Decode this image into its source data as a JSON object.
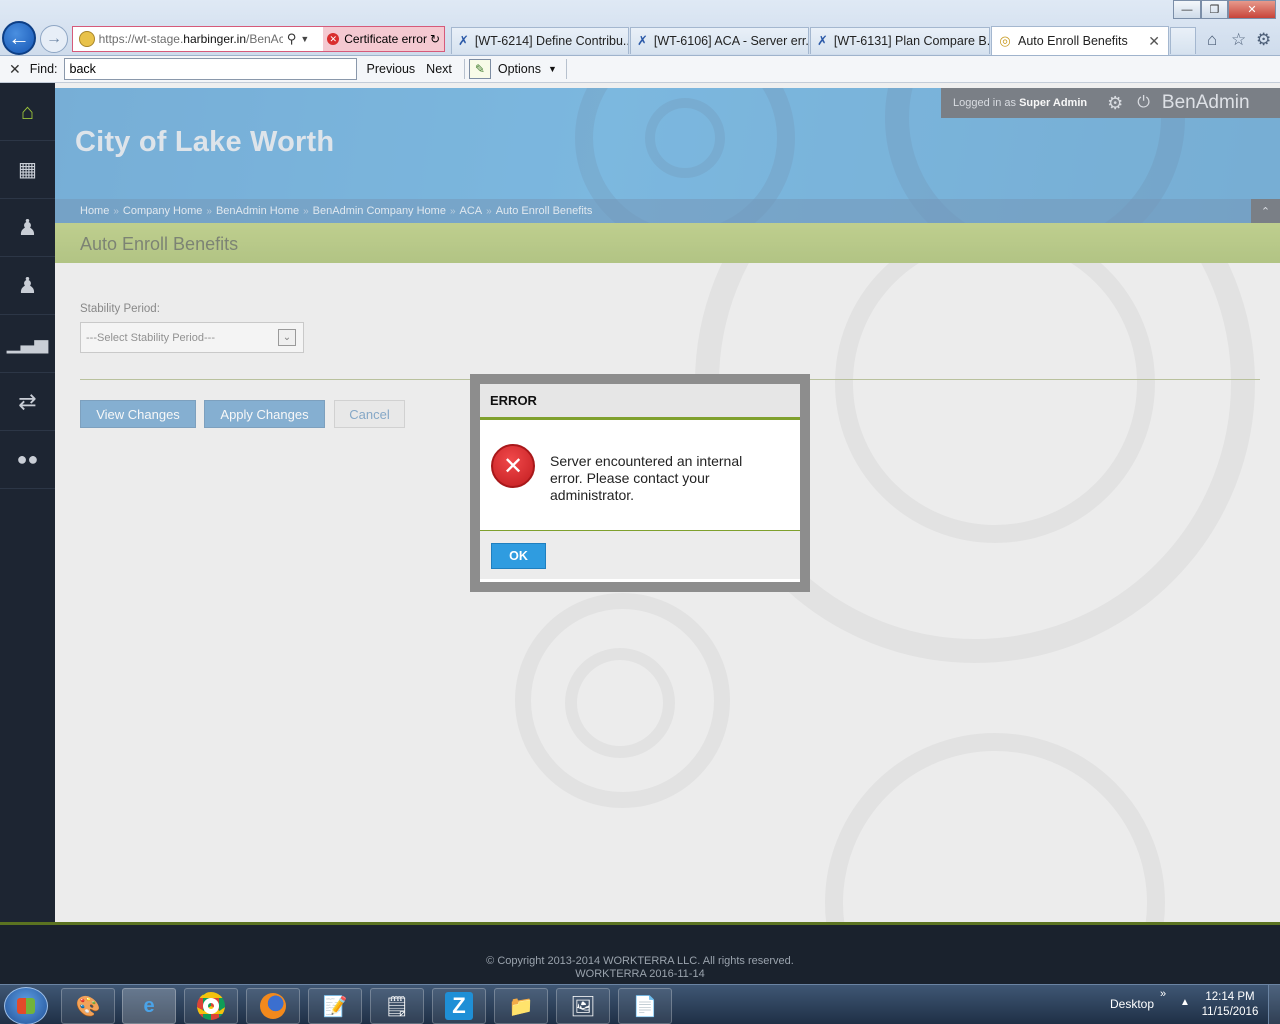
{
  "browser": {
    "url_prefix": "https://wt-stage.",
    "url_domain": "harbinger.in",
    "url_suffix": "/BenAc",
    "certificate_error": "Certificate error",
    "tabs": [
      {
        "label": "[WT-6214] Define Contribu..."
      },
      {
        "label": "[WT-6106] ACA - Server err..."
      },
      {
        "label": "[WT-6131] Plan Compare B..."
      },
      {
        "label": "Auto Enroll Benefits"
      }
    ],
    "find": {
      "label": "Find:",
      "value": "back",
      "previous": "Previous",
      "next": "Next",
      "options": "Options"
    }
  },
  "header": {
    "company_name": "City of Lake Worth",
    "logged_in_prefix": "Logged in as ",
    "user": "Super Admin",
    "brand": "BenAdmin"
  },
  "breadcrumb": [
    "Home",
    "Company Home",
    "BenAdmin Home",
    "BenAdmin Company Home",
    "ACA",
    "Auto Enroll Benefits"
  ],
  "page": {
    "title": "Auto Enroll Benefits",
    "stability_label": "Stability Period:",
    "stability_selected": "---Select Stability Period---",
    "buttons": {
      "view": "View Changes",
      "apply": "Apply Changes",
      "cancel": "Cancel"
    }
  },
  "modal": {
    "title": "ERROR",
    "message": "Server encountered an internal error. Please contact your administrator.",
    "ok": "OK"
  },
  "footer": {
    "copyright": "© Copyright 2013-2014 WORKTERRA LLC. All rights reserved.",
    "build": "WORKTERRA 2016-11-14"
  },
  "taskbar": {
    "desktop": "Desktop",
    "time": "12:14 PM",
    "date": "11/15/2016"
  },
  "colors": {
    "accent_green": "#7fa02d",
    "banner_blue": "#1479c2",
    "button_blue": "#2e7ab8",
    "ok_blue": "#2f9ce0",
    "error_red": "#d62a2c"
  }
}
